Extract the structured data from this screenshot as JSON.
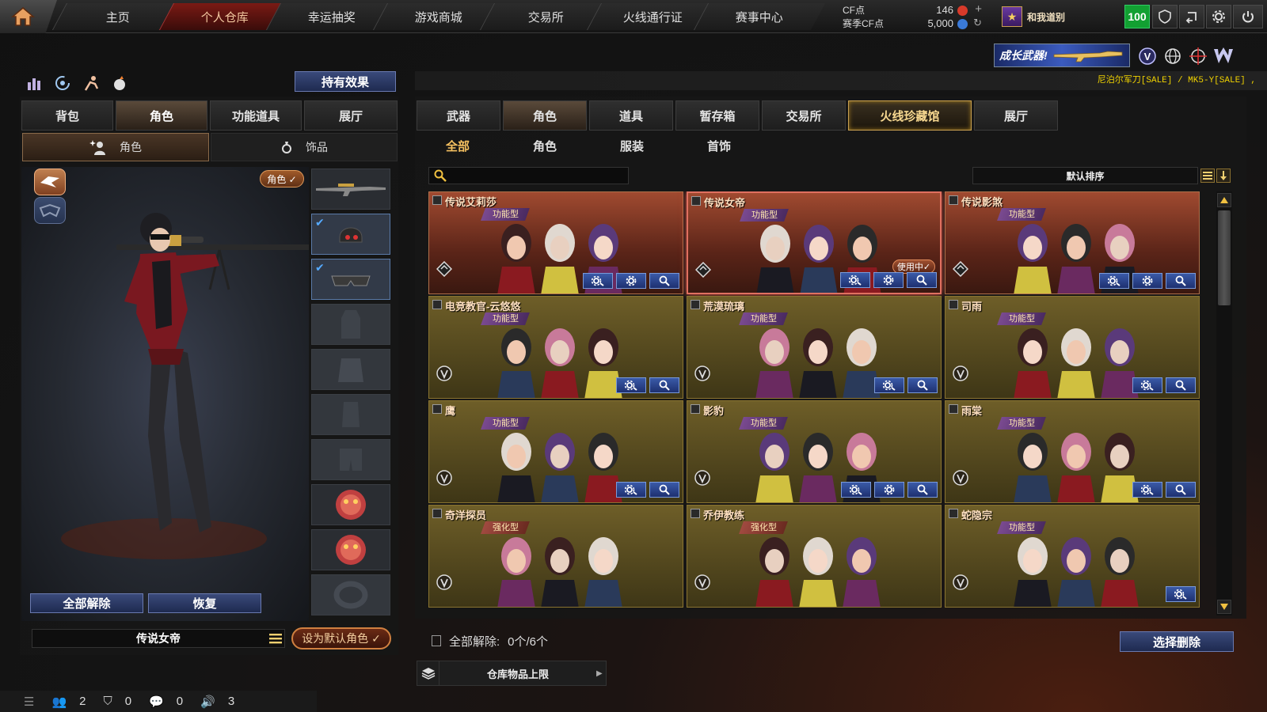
{
  "nav": {
    "tabs": [
      "主页",
      "个人仓库",
      "幸运抽奖",
      "游戏商城",
      "交易所",
      "火线通行证",
      "赛事中心"
    ],
    "active_tab": "个人仓库"
  },
  "points": {
    "cf_label": "CF点",
    "cf_value": "146",
    "season_label": "赛季CF点",
    "season_value": "5,000"
  },
  "user": {
    "name": "和我道别",
    "level": "100"
  },
  "promo": {
    "banner_text": "成长武器!",
    "ticker": "尼泊尔军刀[SALE] / MK5-Y[SALE] ,"
  },
  "left": {
    "effect_button": "持有效果",
    "tabs": [
      "背包",
      "角色",
      "功能道具",
      "展厅"
    ],
    "active_tab": "角色",
    "subtabs": [
      "角色",
      "饰品"
    ],
    "role_badge": "角色 ✓",
    "unequip_all": "全部解除",
    "restore": "恢复",
    "current_name": "传说女帝",
    "set_default": "设为默认角色 ✓"
  },
  "right": {
    "tabs": [
      "武器",
      "角色",
      "道具",
      "暂存箱",
      "交易所",
      "火线珍藏馆",
      "展厅"
    ],
    "active_tab": "角色",
    "highlight_tab": "火线珍藏馆",
    "subtabs": [
      "全部",
      "角色",
      "服装",
      "首饰"
    ],
    "active_subtab": "全部",
    "search_placeholder": "",
    "sort_label": "默认排序",
    "summary_label": "全部解除:",
    "summary_value": "0个/6个",
    "select_delete": "选择删除",
    "limit_label": "仓库物品上限"
  },
  "cards": [
    {
      "name": "传说艾莉莎",
      "type": "功能型",
      "theme": "red",
      "btns": 3,
      "using": ""
    },
    {
      "name": "传说女帝",
      "type": "功能型",
      "theme": "red",
      "btns": 3,
      "using": "使用中✓"
    },
    {
      "name": "传说影煞",
      "type": "功能型",
      "theme": "red",
      "btns": 3,
      "using": ""
    },
    {
      "name": "电竞教官-云悠悠",
      "type": "功能型",
      "theme": "gold",
      "btns": 2,
      "using": ""
    },
    {
      "name": "荒漠琉璃",
      "type": "功能型",
      "theme": "gold",
      "btns": 2,
      "using": ""
    },
    {
      "name": "司雨",
      "type": "功能型",
      "theme": "gold",
      "btns": 2,
      "using": ""
    },
    {
      "name": "鹰",
      "type": "功能型",
      "theme": "gold",
      "btns": 2,
      "using": ""
    },
    {
      "name": "影豹",
      "type": "功能型",
      "theme": "gold",
      "btns": 3,
      "using": ""
    },
    {
      "name": "雨棠",
      "type": "功能型",
      "theme": "gold",
      "btns": 2,
      "using": ""
    },
    {
      "name": "奇洋探员",
      "type": "强化型",
      "theme": "gold",
      "btns": 0,
      "using": ""
    },
    {
      "name": "乔伊教练",
      "type": "强化型",
      "theme": "gold",
      "btns": 0,
      "using": ""
    },
    {
      "name": "蛇隐宗",
      "type": "功能型",
      "theme": "gold",
      "btns": 1,
      "using": ""
    }
  ],
  "statusbar": {
    "friends": "2",
    "clan": "0",
    "chat": "0",
    "voice": "3"
  }
}
